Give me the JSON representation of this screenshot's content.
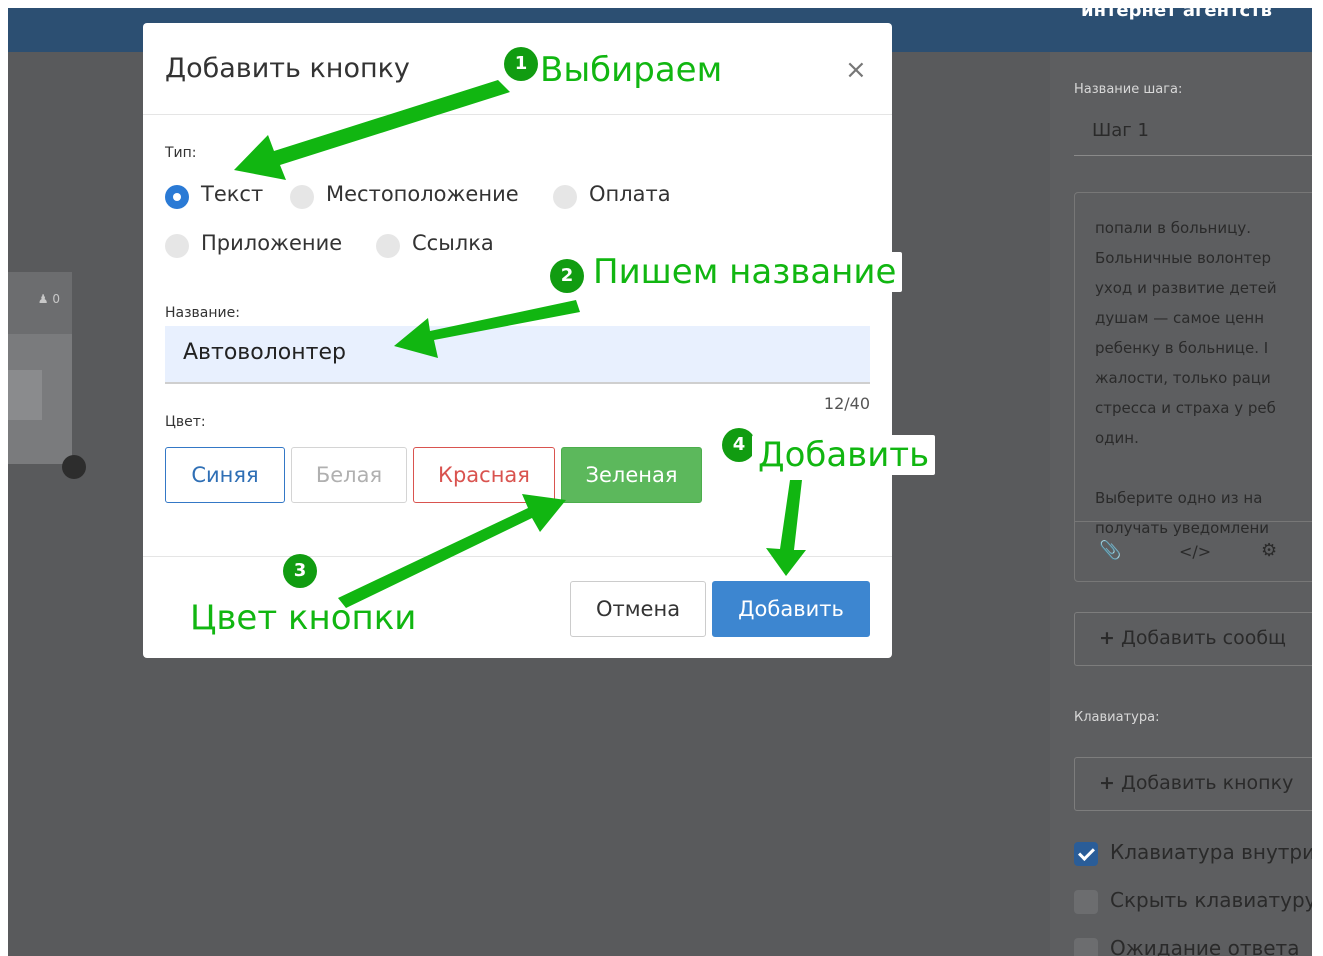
{
  "header": {
    "title_fragment": "интернет агентств"
  },
  "canvas": {
    "node_counter": "0",
    "user_icon": "user-icon"
  },
  "sidebar": {
    "step_name_label": "Название шага:",
    "step_name_value": "Шаг 1",
    "message_text": "попали в больницу.\nБольничные волонтер\nуход и развитие детей\nдушам — самое ценн\nребенку в больнице. I\nжалости, только раци\nстресса и страха у реб\nодин.\n\nВыберите одно из на\nполучать уведомлени",
    "tools": [
      "paperclip-icon",
      "code-icon",
      "gear-icon"
    ],
    "add_message_label": "Добавить сообщ",
    "keyboard_label": "Клавиатура:",
    "add_button_label": "Добавить кнопку",
    "checkboxes": [
      {
        "label": "Клавиатура внутри",
        "checked": true
      },
      {
        "label": "Скрыть клавиатуру",
        "checked": false
      },
      {
        "label": "Ожидание ответа",
        "checked": false
      }
    ]
  },
  "modal": {
    "title": "Добавить кнопку",
    "close_label": "×",
    "type_label": "Тип:",
    "types": [
      {
        "label": "Текст",
        "selected": true
      },
      {
        "label": "Местоположение",
        "selected": false
      },
      {
        "label": "Оплата",
        "selected": false
      },
      {
        "label": "Приложение",
        "selected": false
      },
      {
        "label": "Ссылка",
        "selected": false
      }
    ],
    "name_label": "Название:",
    "name_value": "Автоволонтер",
    "counter": "12/40",
    "color_label": "Цвет:",
    "colors": [
      "Синяя",
      "Белая",
      "Красная",
      "Зеленая"
    ],
    "selected_color": "Зеленая",
    "cancel_label": "Отмена",
    "add_label": "Добавить"
  },
  "annotations": {
    "step1": {
      "number": "1",
      "text": "Выбираем"
    },
    "step2": {
      "number": "2",
      "text": "Пишем название"
    },
    "step3": {
      "number": "3",
      "text": "Цвет кнопки"
    },
    "step4": {
      "number": "4",
      "text": "Добавить"
    },
    "color": "#11b611"
  }
}
